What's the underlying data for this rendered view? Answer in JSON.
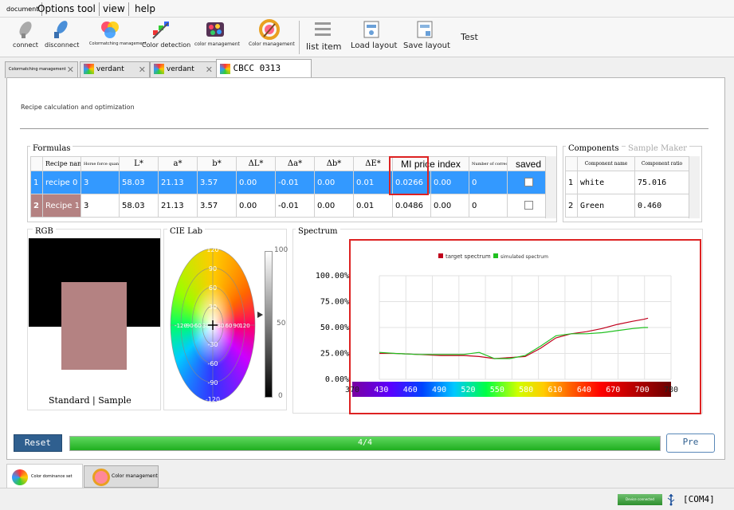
{
  "menu": {
    "document": "document",
    "options_tool": "Options tool",
    "view": "view",
    "help": "help"
  },
  "toolbar": {
    "connect": "connect",
    "disconnect": "disconnect",
    "colormatching": "Colormatching management",
    "color_detection": "Color detection",
    "color_management_1": "color management",
    "color_management_2": "Color management",
    "list_item": "list item",
    "load_layout": "Load layout",
    "save_layout": "Save layout",
    "test": "Test"
  },
  "tabs": [
    {
      "label": "Colormatching management"
    },
    {
      "label": "verdant"
    },
    {
      "label": "verdant"
    },
    {
      "label": "CBCC 0313"
    }
  ],
  "main": {
    "section_title": "Recipe calculation and optimization"
  },
  "formulas": {
    "title": "Formulas",
    "columns": [
      "Recipe name",
      "Horse force quantity",
      "L*",
      "a*",
      "b*",
      "ΔL*",
      "Δa*",
      "Δb*",
      "ΔE*",
      "MI price index",
      "",
      "Number of corrections",
      "saved"
    ],
    "rows": [
      {
        "num": "1",
        "name": "recipe 0",
        "qty": "3",
        "L": "58.03",
        "a": "21.13",
        "b": "3.57",
        "dL": "0.00",
        "da": "-0.01",
        "db": "0.00",
        "dE": "0.01",
        "mi": "0.0266",
        "blank": "0.00",
        "corr": "0"
      },
      {
        "num": "2",
        "name": "Recipe 1",
        "qty": "3",
        "L": "58.03",
        "a": "21.13",
        "b": "3.57",
        "dL": "0.00",
        "da": "-0.01",
        "db": "0.00",
        "dE": "0.01",
        "mi": "0.0486",
        "blank": "0.00",
        "corr": "0"
      }
    ]
  },
  "components": {
    "tab_active": "Components",
    "tab_inactive": "Sample Maker",
    "columns": [
      "Component name",
      "Component ratio"
    ],
    "rows": [
      {
        "num": "1",
        "name": "white",
        "ratio": "75.016"
      },
      {
        "num": "2",
        "name": "Green",
        "ratio": "0.460"
      }
    ]
  },
  "rgb": {
    "title": "RGB",
    "caption": "Standard | Sample",
    "standard_color": "#000000",
    "sample_color": "#b48282"
  },
  "cielab": {
    "title": "CIE Lab",
    "ring_labels": [
      "120",
      "90",
      "60",
      "30",
      "-30",
      "-60",
      "-90",
      "-120"
    ],
    "axis_labels": [
      "-120",
      "-90",
      "-60",
      "-30",
      "30",
      "60",
      "90",
      "120"
    ],
    "scale": [
      "100",
      "50",
      "0"
    ]
  },
  "spectrum": {
    "title": "Spectrum",
    "legend": {
      "target": "target spectrum",
      "simulated": "simulated spectrum"
    },
    "colors": {
      "target": "#c0001c",
      "simulated": "#20c020",
      "highlight": "#dd2222"
    }
  },
  "chart_data": {
    "type": "line",
    "ylim": [
      0,
      100
    ],
    "xlim": [
      370,
      780
    ],
    "yticks": [
      "100.00%",
      "75.00%",
      "50.00%",
      "25.00%",
      "0.00%"
    ],
    "xticks": [
      "370",
      "430",
      "460",
      "490",
      "520",
      "550",
      "580",
      "610",
      "640",
      "670",
      "700",
      "780"
    ],
    "series": [
      {
        "name": "target spectrum",
        "x": [
          400,
          420,
          450,
          480,
          510,
          530,
          550,
          570,
          590,
          610,
          630,
          650,
          670,
          690,
          710,
          730,
          745,
          750
        ],
        "y": [
          25,
          25,
          24,
          23,
          23,
          22,
          20,
          21,
          22,
          30,
          40,
          44,
          46,
          49,
          53,
          56,
          58,
          59
        ]
      },
      {
        "name": "simulated spectrum",
        "x": [
          400,
          420,
          450,
          480,
          510,
          530,
          550,
          570,
          590,
          610,
          630,
          650,
          670,
          690,
          710,
          730,
          745,
          750
        ],
        "y": [
          26,
          25,
          24,
          24,
          24,
          26,
          20,
          20,
          23,
          32,
          42,
          44,
          44,
          45,
          47,
          49,
          50,
          50
        ]
      }
    ]
  },
  "bottom": {
    "reset": "Reset",
    "progress_text": "4/4",
    "progress": 1.0,
    "pre": "Pre"
  },
  "footer_tabs": [
    "Color dominance set",
    "Color management"
  ],
  "status": {
    "bar_text": "Device connected",
    "port": "[COM4]"
  }
}
